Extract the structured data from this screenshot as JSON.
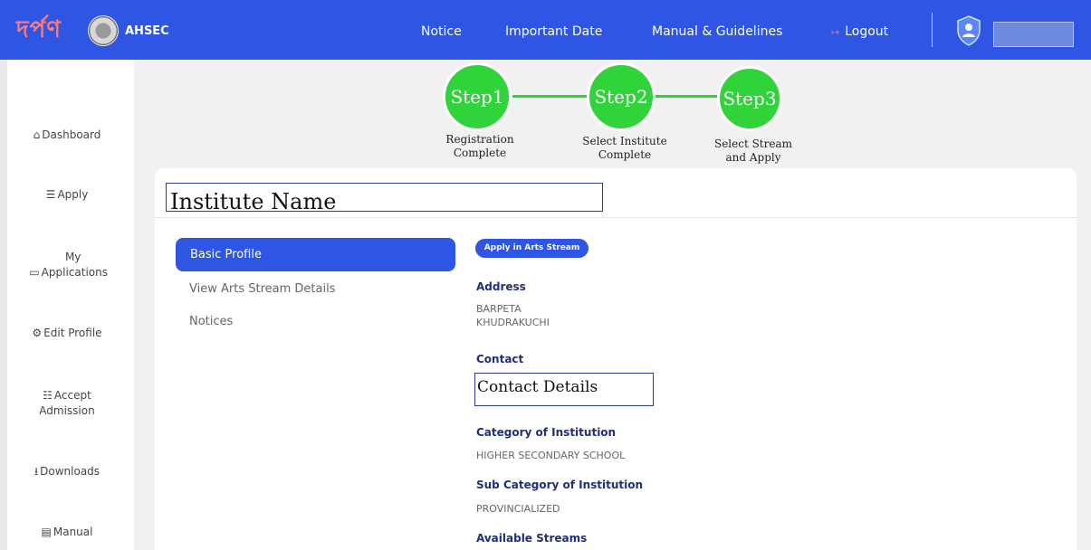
{
  "header": {
    "logo_text": "দৰ্পণ",
    "brand": "AHSEC",
    "nav": {
      "notice": "Notice",
      "important_date": "Important Date",
      "manual_guidelines": "Manual & Guidelines",
      "logout": "Logout"
    },
    "user_name": ""
  },
  "sidebar": {
    "items": [
      {
        "icon": "home-icon",
        "label": "Dashboard"
      },
      {
        "icon": "form-icon",
        "label": "Apply"
      },
      {
        "icon": "folder-icon",
        "label": "My Applications"
      },
      {
        "icon": "edit-profile-icon",
        "label": "Edit Profile"
      },
      {
        "icon": "admission-icon",
        "label": "Accept Admission"
      },
      {
        "icon": "download-icon",
        "label": "Downloads"
      },
      {
        "icon": "manual-icon",
        "label": "Manual"
      }
    ]
  },
  "steps": [
    {
      "title": "Step1",
      "caption_line1": "Registration",
      "caption_line2": "Complete"
    },
    {
      "title": "Step2",
      "caption_line1": "Select Institute",
      "caption_line2": "Complete"
    },
    {
      "title": "Step3",
      "caption_line1": "Select Stream",
      "caption_line2": "and Apply"
    }
  ],
  "institute": {
    "name": "Institute Name"
  },
  "menu": {
    "active": "Basic Profile",
    "items": [
      "View Arts Stream Details",
      "Notices"
    ]
  },
  "profile": {
    "apply_button": "Apply in Arts Stream",
    "address_label": "Address",
    "address_line1": "BARPETA",
    "address_line2": "KHUDRAKUCHI",
    "contact_label": "Contact",
    "contact_value": "Contact Details",
    "category_label": "Category of Institution",
    "category_value": "HIGHER SECONDARY SCHOOL",
    "subcategory_label": "Sub Category of Institution",
    "subcategory_value": "PROVINCIALIZED",
    "streams_label": "Available Streams"
  },
  "colors": {
    "primary": "#2f55e4",
    "step_green": "#31d33a",
    "label_navy": "#1f2f7a"
  }
}
